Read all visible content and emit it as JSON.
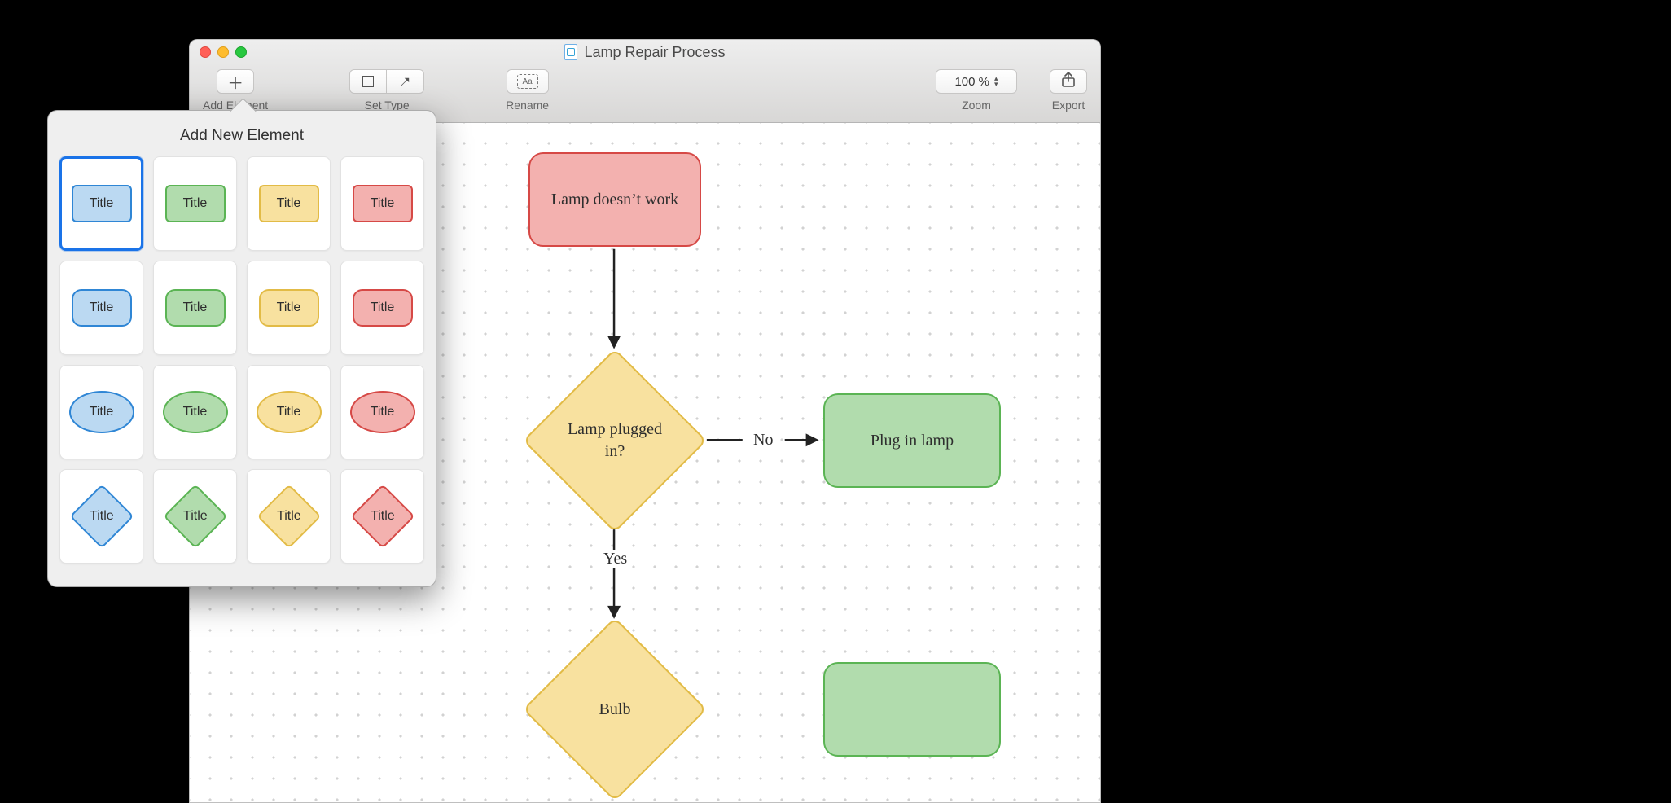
{
  "window": {
    "title": "Lamp Repair Process"
  },
  "toolbar": {
    "add_element": "Add Element",
    "set_type": "Set Type",
    "rename": "Rename",
    "rename_glyph": "Aa",
    "zoom_value": "100 %",
    "zoom": "Zoom",
    "export": "Export"
  },
  "flow": {
    "n1": "Lamp doesn’t work",
    "n2": "Lamp plugged in?",
    "n3": "Plug in lamp",
    "n4": "Bulb",
    "e_no": "No",
    "e_yes": "Yes"
  },
  "popover": {
    "title": "Add New Element",
    "sample": "Title"
  }
}
